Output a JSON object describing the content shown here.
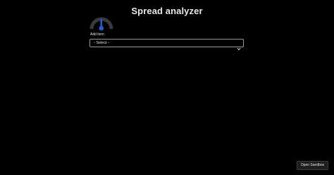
{
  "page": {
    "title": "Spread analyzer"
  },
  "gauge": {
    "icon": "gauge-icon",
    "colors": {
      "track": "#3a3a3a",
      "needle": "#1f5fd6"
    }
  },
  "add_item": {
    "label": "Add item",
    "selected_option": "- Select -"
  },
  "footer": {
    "sandbox_label": "Open Sandbox"
  },
  "colors": {
    "background": "#000000",
    "text": "#e6e6e6",
    "accent": "#1f5fd6"
  }
}
